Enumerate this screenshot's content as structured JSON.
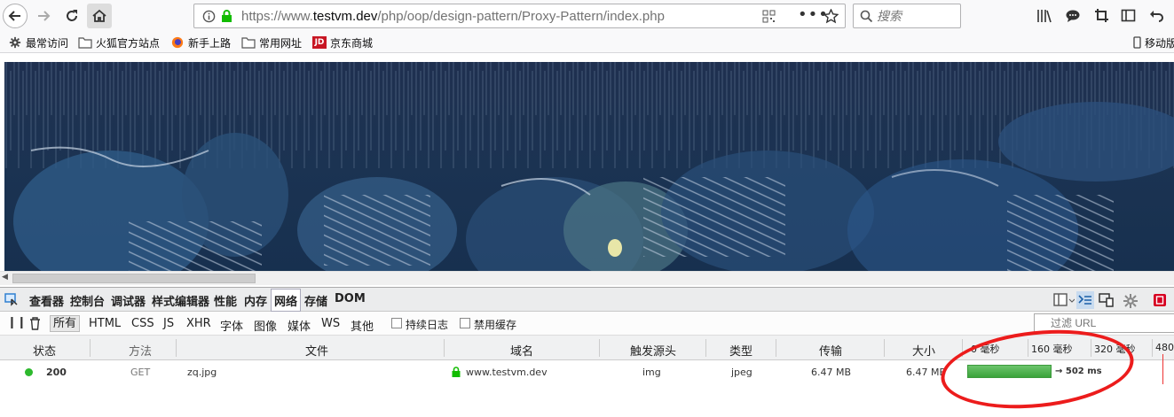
{
  "browser": {
    "url_prefix": "https://www.",
    "url_host": "testvm.dev",
    "url_path": "/php/oop/design-pattern/Proxy-Pattern/index.php",
    "search_placeholder": "搜索"
  },
  "bookmarks": {
    "items": [
      "最常访问",
      "火狐官方站点",
      "新手上路",
      "常用网址",
      "京东商城"
    ],
    "mobile": "移动版"
  },
  "devtools": {
    "tabs": [
      "查看器",
      "控制台",
      "调试器",
      "样式编辑器",
      "性能",
      "内存",
      "网络",
      "存储",
      "DOM"
    ],
    "active_tab": "网络",
    "filters": [
      "所有",
      "HTML",
      "CSS",
      "JS",
      "XHR",
      "字体",
      "图像",
      "媒体",
      "WS",
      "其他"
    ],
    "persist_log": "持续日志",
    "disable_cache": "禁用缓存",
    "filter_placeholder": "过滤 URL",
    "columns": [
      "状态",
      "方法",
      "文件",
      "域名",
      "触发源头",
      "类型",
      "传输",
      "大小"
    ],
    "timeline_ticks": [
      "0 毫秒",
      "160 毫秒",
      "320 毫秒",
      "480"
    ],
    "request": {
      "status": "200",
      "method": "GET",
      "file": "zq.jpg",
      "domain": "www.testvm.dev",
      "cause": "img",
      "type": "jpeg",
      "transferred": "6.47 MB",
      "size": "6.47 MB",
      "duration": "→ 502 ms"
    }
  },
  "colors": {
    "status_ok": "#2db92d",
    "timing_bar": "#4cae4c",
    "annotation": "#ec1c1c"
  }
}
